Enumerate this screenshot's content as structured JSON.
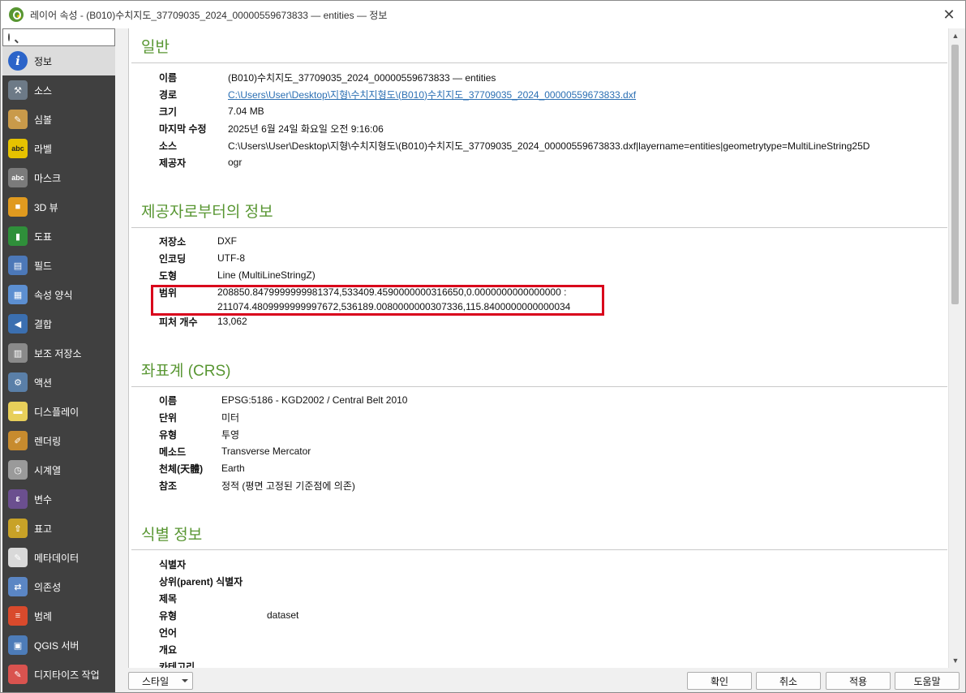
{
  "window": {
    "title": "레이어 속성 - (B010)수치지도_37709035_2024_00000559673833 — entities — 정보",
    "close_label": "✕"
  },
  "sidebar": {
    "search_placeholder": "",
    "items": [
      {
        "label": "정보",
        "icon": "info-icon",
        "color": "#2b64c9",
        "active": true
      },
      {
        "label": "소스",
        "icon": "source-tools-icon",
        "color": "#6d7a87"
      },
      {
        "label": "심볼",
        "icon": "symbology-brush-icon",
        "color": "#c99a4a"
      },
      {
        "label": "라벨",
        "icon": "labels-abc-icon",
        "color": "#e6c200"
      },
      {
        "label": "마스크",
        "icon": "mask-abc-icon",
        "color": "#7b7b7b"
      },
      {
        "label": "3D 뷰",
        "icon": "cube-3d-icon",
        "color": "#e09a1f"
      },
      {
        "label": "도표",
        "icon": "diagram-icon",
        "color": "#2f8f3a"
      },
      {
        "label": "필드",
        "icon": "fields-table-icon",
        "color": "#4c78b8"
      },
      {
        "label": "속성 양식",
        "icon": "attributes-form-icon",
        "color": "#5c8fd1"
      },
      {
        "label": "결합",
        "icon": "joins-icon",
        "color": "#3b6fb0"
      },
      {
        "label": "보조 저장소",
        "icon": "auxiliary-storage-icon",
        "color": "#8a8a8a"
      },
      {
        "label": "액션",
        "icon": "actions-gear-icon",
        "color": "#5a7fa8"
      },
      {
        "label": "디스플레이",
        "icon": "display-tip-icon",
        "color": "#e8cf5a"
      },
      {
        "label": "렌더링",
        "icon": "rendering-brush-icon",
        "color": "#c78b2e"
      },
      {
        "label": "시계열",
        "icon": "temporal-clock-icon",
        "color": "#9a9a9a"
      },
      {
        "label": "변수",
        "icon": "variables-epsilon-icon",
        "color": "#6b4f8f"
      },
      {
        "label": "표고",
        "icon": "elevation-icon",
        "color": "#c8a227"
      },
      {
        "label": "메타데이터",
        "icon": "metadata-icon",
        "color": "#d9d9d9"
      },
      {
        "label": "의존성",
        "icon": "dependencies-icon",
        "color": "#5b86c4"
      },
      {
        "label": "범례",
        "icon": "legend-icon",
        "color": "#d94a2c"
      },
      {
        "label": "QGIS 서버",
        "icon": "qgis-server-icon",
        "color": "#4d7cb8"
      },
      {
        "label": "디지타이즈 작업",
        "icon": "digitizing-icon",
        "color": "#d9534f"
      }
    ]
  },
  "sections": {
    "general": {
      "heading": "일반",
      "rows": [
        {
          "key": "이름",
          "value": "(B010)수치지도_37709035_2024_00000559673833 — entities"
        },
        {
          "key": "경로",
          "value": "C:\\Users\\User\\Desktop\\지형\\수치지형도\\(B010)수치지도_37709035_2024_00000559673833.dxf"
        },
        {
          "key": "크기",
          "value": "7.04 MB"
        },
        {
          "key": "마지막 수정",
          "value": "2025년 6월 24일 화요일 오전 9:16:06"
        },
        {
          "key": "소스",
          "value": "C:\\Users\\User\\Desktop\\지형\\수치지형도\\(B010)수치지도_37709035_2024_00000559673833.dxf|layername=entities|geometrytype=MultiLineString25D"
        },
        {
          "key": "제공자",
          "value": "ogr"
        }
      ]
    },
    "provider": {
      "heading": "제공자로부터의 정보",
      "rows": [
        {
          "key": "저장소",
          "value": "DXF"
        },
        {
          "key": "인코딩",
          "value": "UTF-8"
        },
        {
          "key": "도형",
          "value": "Line (MultiLineStringZ)"
        },
        {
          "key": "범위",
          "value": "208850.8479999999981374,533409.4590000000316650,0.0000000000000000 :",
          "value2": "211074.4809999999997672,536189.0080000000307336,115.8400000000000034"
        },
        {
          "key": "피처 개수",
          "value": "13,062"
        }
      ]
    },
    "crs": {
      "heading": "좌표계 (CRS)",
      "rows": [
        {
          "key": "이름",
          "value": "EPSG:5186 - KGD2002 / Central Belt 2010"
        },
        {
          "key": "단위",
          "value": "미터"
        },
        {
          "key": "유형",
          "value": "투영"
        },
        {
          "key": "메소드",
          "value": "Transverse Mercator"
        },
        {
          "key": "천체(天體)",
          "value": "Earth"
        },
        {
          "key": "참조",
          "value": "정적 (평면 고정된 기준점에 의존)"
        }
      ]
    },
    "identification": {
      "heading": "식별 정보",
      "rows": [
        {
          "key": "식별자",
          "value": ""
        },
        {
          "key": "상위(parent) 식별자",
          "value": ""
        },
        {
          "key": "제목",
          "value": ""
        },
        {
          "key": "유형",
          "value": "dataset"
        },
        {
          "key": "언어",
          "value": ""
        },
        {
          "key": "개요",
          "value": ""
        },
        {
          "key": "카테고리",
          "value": ""
        }
      ]
    }
  },
  "buttons": {
    "style": "스타일",
    "ok": "확인",
    "cancel": "취소",
    "apply": "적용",
    "help": "도움말"
  },
  "colors": {
    "heading_green": "#589632",
    "highlight_red": "#d9001b",
    "sidebar_bg": "#404040",
    "link_blue": "#2b6fb3"
  }
}
